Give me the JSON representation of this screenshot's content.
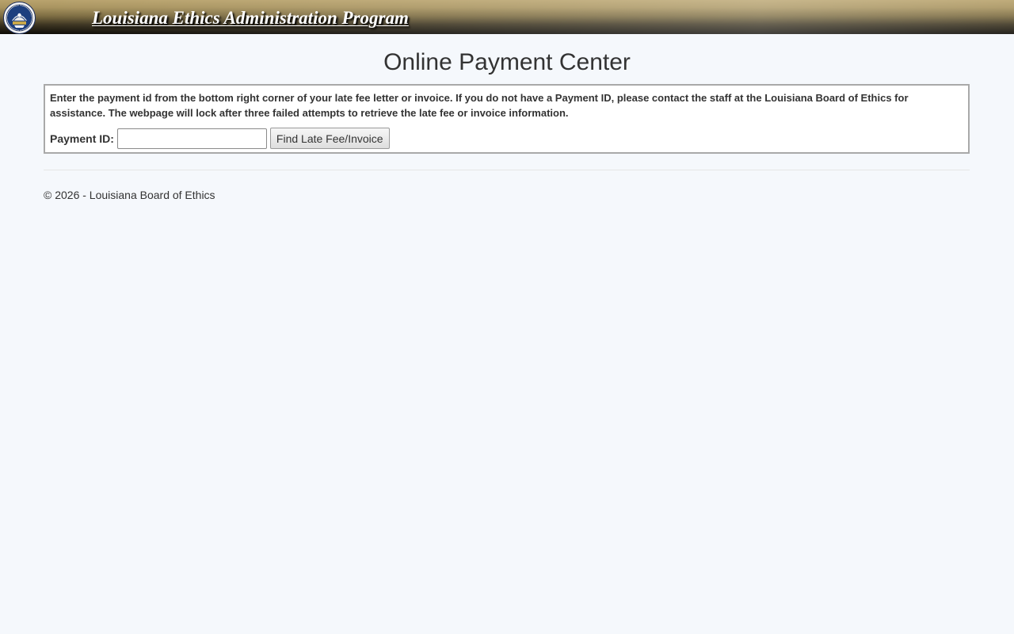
{
  "header": {
    "title": "Louisiana Ethics Administration Program",
    "seal_icon": "state-seal-icon"
  },
  "main": {
    "title": "Online Payment Center",
    "instructions": "Enter the payment id from the bottom right corner of your late fee letter or invoice. If you do not have a Payment ID, please contact the staff at the Louisiana Board of Ethics for assistance. The webpage will lock after three failed attempts to retrieve the late fee or invoice information.",
    "payment_id_label": "Payment ID:",
    "payment_id_value": "",
    "find_button_label": "Find Late Fee/Invoice"
  },
  "footer": {
    "copyright": "© 2026 - Louisiana Board of Ethics"
  },
  "colors": {
    "banner_gold": "#b8a26c",
    "banner_dark": "#0c0a05",
    "page_background": "#f5f8fc",
    "text": "#333333",
    "box_border": "#a9a9a9"
  }
}
